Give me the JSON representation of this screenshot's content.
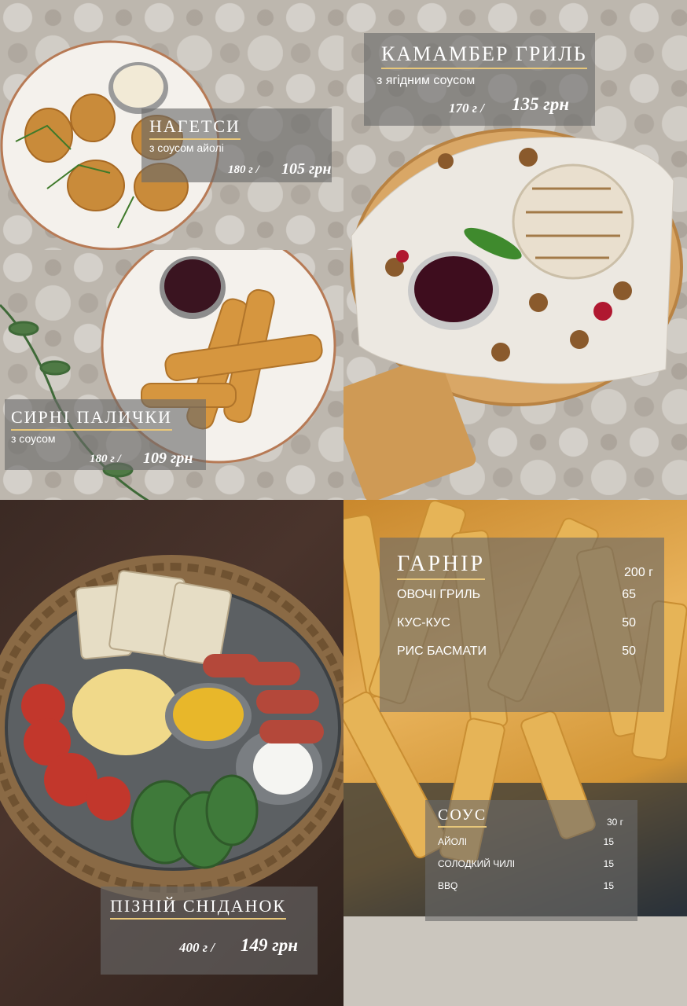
{
  "nuggets": {
    "title": "НАГЕТСИ",
    "subtitle": "з соусом айолі",
    "weight": "180 г /",
    "price": "105 грн"
  },
  "sticks": {
    "title": "СИРНІ ПАЛИЧКИ",
    "subtitle": "з соусом",
    "weight": "180 г /",
    "price": "109 грн"
  },
  "camembert": {
    "title": "КАМАМБЕР ГРИЛЬ",
    "subtitle": "з ягідним соусом",
    "weight": "170 г /",
    "price": "135 грн"
  },
  "brunch": {
    "title": "ПІЗНІЙ СНІДАНОК",
    "weight": "400 г /",
    "price": "149 грн"
  },
  "garnish": {
    "title": "ГАРНІР",
    "unit": "200 г",
    "items": [
      {
        "name": "ОВОЧІ ГРИЛЬ",
        "price": "65"
      },
      {
        "name": "КУС-КУС",
        "price": "50"
      },
      {
        "name": "РИС БАСМАТИ",
        "price": "50"
      }
    ]
  },
  "sauce": {
    "title": "СОУС",
    "unit": "30 г",
    "items": [
      {
        "name": "АЙОЛІ",
        "price": "15"
      },
      {
        "name": "СОЛОДКИЙ ЧИЛІ",
        "price": "15"
      },
      {
        "name": "BBQ",
        "price": "15"
      }
    ]
  },
  "colors": {
    "accent": "#e8c77a",
    "overlay": "#696969"
  }
}
